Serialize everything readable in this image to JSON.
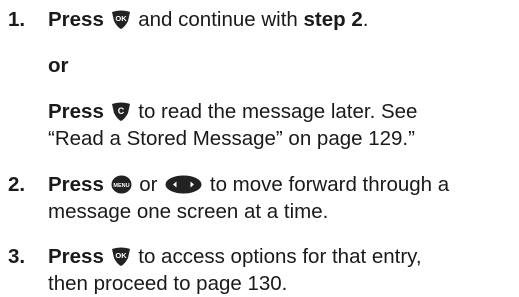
{
  "steps": [
    {
      "number": "1.",
      "press": "Press",
      "key_ok": "OK",
      "text_a": " and continue with ",
      "bold_ref": "step 2",
      "text_end": "."
    },
    {
      "number": "2.",
      "press": "Press",
      "key_menu": "MENU",
      "text_or": " or ",
      "text_a": " to move forward through a",
      "text_b": "message one screen at a time."
    },
    {
      "number": "3.",
      "press": "Press",
      "key_ok": "OK",
      "text_a": " to access options for that entry,",
      "text_b": "then proceed to page 130."
    }
  ],
  "alternative": {
    "or_label": "or",
    "press": "Press",
    "key_c": "C",
    "text_a": " to read the message later. See",
    "text_b": "“Read a Stored Message” on page 129.”"
  },
  "colors": {
    "text": "#1a1a1a",
    "key_fill": "#222222",
    "key_label": "#ffffff"
  },
  "icons": [
    "ok-key-icon",
    "c-key-icon",
    "menu-key-icon",
    "left-right-nav-key-icon"
  ]
}
